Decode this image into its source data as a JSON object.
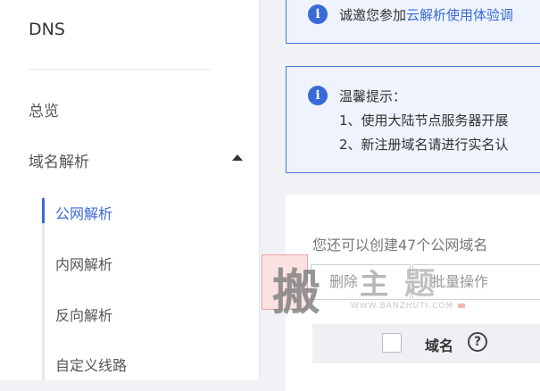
{
  "sidebar": {
    "brand": "DNS",
    "overview": "总览",
    "domain_resolution": "域名解析",
    "sub_items": [
      "公网解析",
      "内网解析",
      "反向解析",
      "自定义线路"
    ]
  },
  "notice_top": {
    "text_prefix": "诚邀您参加",
    "link_text": "云解析使用体验调"
  },
  "notice_warn": {
    "title": "温馨提示：",
    "line1": "1、使用大陆节点服务器开展",
    "line2": "2、新注册域名请进行实名认"
  },
  "panel": {
    "quota_text": "您还可以创建47个公网域名",
    "delete_button": "删除",
    "batch_button": "批量操作",
    "col_domain": "域名",
    "help_glyph": "?"
  },
  "watermark": {
    "char1": "搬",
    "char2": "主",
    "char3": "题",
    "url": "WWW.BANZHUTI.COM"
  },
  "colors": {
    "accent": "#3a6ad8",
    "notice_bg": "#eef3fd",
    "page_bg": "#f0f2f5"
  }
}
